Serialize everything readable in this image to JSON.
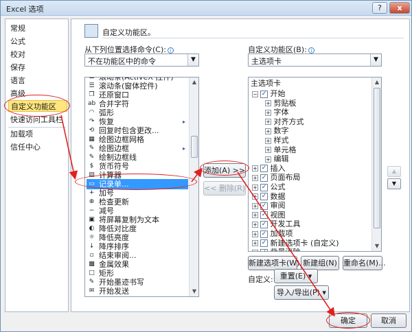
{
  "window": {
    "title": "Excel 选项",
    "help_label": "?",
    "close_label": "x"
  },
  "nav": {
    "items": [
      "常规",
      "公式",
      "校对",
      "保存",
      "语言",
      "高级",
      "自定义功能区",
      "快速访问工具栏",
      "加载项",
      "信任中心"
    ],
    "selected_index": 6
  },
  "header": {
    "title": "自定义功能区。"
  },
  "left": {
    "label": "从下列位置选择命令(C):",
    "dropdown_value": "不在功能区中的命令",
    "commands": [
      {
        "icon": "☰",
        "label": "滚动条(ActiveX 控件)"
      },
      {
        "icon": "☰",
        "label": "滚动条(窗体控件)"
      },
      {
        "icon": "❐",
        "label": "还原窗口"
      },
      {
        "icon": "ab",
        "label": "合并字符"
      },
      {
        "icon": "◠",
        "label": "弧形"
      },
      {
        "icon": "↷",
        "label": "恢复",
        "submenu": "▸"
      },
      {
        "icon": "⟲",
        "label": "回复时包含更改..."
      },
      {
        "icon": "▦",
        "label": "绘图边框网格"
      },
      {
        "icon": "✎",
        "label": "绘图边框",
        "submenu": "▸"
      },
      {
        "icon": "✎",
        "label": "绘制边框线"
      },
      {
        "icon": "$",
        "label": "货币符号"
      },
      {
        "icon": "▤",
        "label": "计算器"
      },
      {
        "icon": "▭",
        "label": "记录单..."
      },
      {
        "icon": "+",
        "label": "加号"
      },
      {
        "icon": "⊕",
        "label": "检查更新"
      },
      {
        "icon": "−",
        "label": "减号"
      },
      {
        "icon": "▣",
        "label": "将屏幕复制为文本"
      },
      {
        "icon": "◐",
        "label": "降低对比度"
      },
      {
        "icon": "☼",
        "label": "降低亮度"
      },
      {
        "icon": "↓",
        "label": "降序排序"
      },
      {
        "icon": "▫",
        "label": "结束审阅..."
      },
      {
        "icon": "▩",
        "label": "金属效果"
      },
      {
        "icon": "□",
        "label": "矩形"
      },
      {
        "icon": "✎",
        "label": "开始墨迹书写"
      },
      {
        "icon": "✉",
        "label": "开始发送"
      }
    ],
    "selected_index": 12
  },
  "middle": {
    "add_label": "添加(A) >>",
    "remove_label": "<< 删除(R)"
  },
  "right": {
    "label": "自定义功能区(B):",
    "dropdown_value": "主选项卡",
    "tree_header": "主选项卡",
    "tree": [
      {
        "level": 0,
        "expander": "⊟",
        "checked": true,
        "label": "开始"
      },
      {
        "level": 1,
        "expander": "⊞",
        "label": "剪贴板"
      },
      {
        "level": 1,
        "expander": "⊞",
        "label": "字体"
      },
      {
        "level": 1,
        "expander": "⊞",
        "label": "对齐方式"
      },
      {
        "level": 1,
        "expander": "⊞",
        "label": "数字"
      },
      {
        "level": 1,
        "expander": "⊞",
        "label": "样式"
      },
      {
        "level": 1,
        "expander": "⊞",
        "label": "单元格"
      },
      {
        "level": 1,
        "expander": "⊞",
        "label": "编辑"
      },
      {
        "level": 0,
        "expander": "⊞",
        "checked": true,
        "label": "插入"
      },
      {
        "level": 0,
        "expander": "⊞",
        "checked": true,
        "label": "页面布局"
      },
      {
        "level": 0,
        "expander": "⊞",
        "checked": true,
        "label": "公式"
      },
      {
        "level": 0,
        "expander": "⊞",
        "checked": true,
        "label": "数据"
      },
      {
        "level": 0,
        "expander": "⊞",
        "checked": true,
        "label": "审阅"
      },
      {
        "level": 0,
        "expander": "⊞",
        "checked": true,
        "label": "视图"
      },
      {
        "level": 0,
        "expander": "⊞",
        "checked": true,
        "label": "开发工具"
      },
      {
        "level": 0,
        "expander": "⊞",
        "checked": true,
        "label": "加载项"
      },
      {
        "level": 0,
        "expander": "⊞",
        "checked": true,
        "label": "新建选项卡 (自定义)"
      },
      {
        "level": 0,
        "expander": "⊞",
        "checked": true,
        "label": "背景消除"
      }
    ],
    "new_tab_label": "新建选项卡(W)",
    "new_group_label": "新建组(N)",
    "rename_label": "重命名(M)...",
    "customize_label": "自定义:",
    "reset_label": "重置(E) ▾",
    "import_export_label": "导入/导出(P) ▾",
    "move_up_icon": "▲",
    "move_down_icon": "▼"
  },
  "footer": {
    "ok_label": "确定",
    "cancel_label": "取消"
  },
  "colors": {
    "selection": "#3399ff",
    "nav_selected": "#ffe67c",
    "annotation": "#e02020"
  }
}
